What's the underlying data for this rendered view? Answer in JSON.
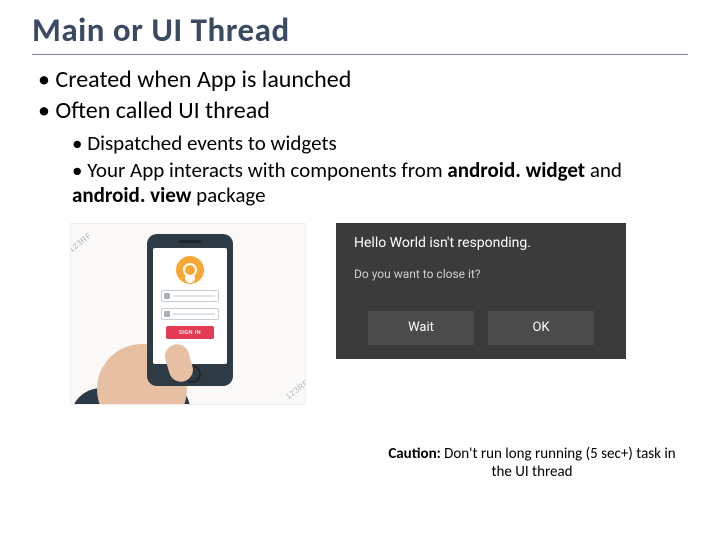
{
  "title": "Main or UI Thread",
  "bullets_top": [
    "Created when App is launched",
    "Often called UI thread"
  ],
  "bullets_sub": {
    "b1": "Dispatched events to widgets",
    "b2_pre": "Your App interacts with components from ",
    "b2_bold1": "android. widget",
    "b2_mid": " and ",
    "b2_bold2": "android. view",
    "b2_post": " package"
  },
  "phone": {
    "signin": "SIGN IN",
    "watermark": "123RF"
  },
  "anr": {
    "title": "Hello World isn't responding.",
    "sub": "Do you want to close it?",
    "wait": "Wait",
    "ok": "OK"
  },
  "caution": {
    "label": "Caution:",
    "text": " Don't run long running (5 sec+) task in the UI thread"
  }
}
